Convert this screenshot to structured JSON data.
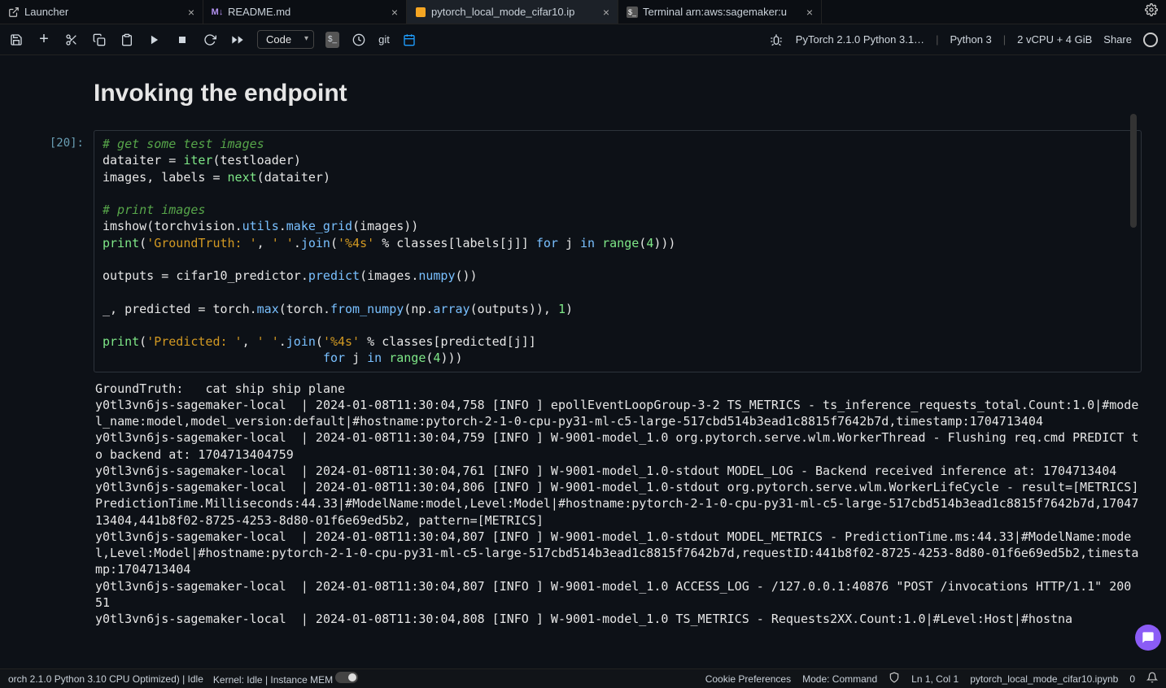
{
  "tabs": [
    {
      "label": "Launcher",
      "icon": "external"
    },
    {
      "label": "README.md",
      "icon": "markdown"
    },
    {
      "label": "pytorch_local_mode_cifar10.ip",
      "icon": "notebook",
      "active": true
    },
    {
      "label": "Terminal arn:aws:sagemaker:u",
      "icon": "terminal"
    }
  ],
  "toolbar": {
    "dropdown": "Code",
    "git_label": "git"
  },
  "toolbar_right": {
    "runtime": "PyTorch 2.1.0 Python 3.1…",
    "kernel": "Python 3",
    "compute": "2 vCPU + 4 GiB",
    "share": "Share"
  },
  "section_title": "Invoking the endpoint",
  "cell": {
    "prompt": "[20]:"
  },
  "output_text": "GroundTruth:   cat ship ship plane\ny0tl3vn6js-sagemaker-local  | 2024-01-08T11:30:04,758 [INFO ] epollEventLoopGroup-3-2 TS_METRICS - ts_inference_requests_total.Count:1.0|#model_name:model,model_version:default|#hostname:pytorch-2-1-0-cpu-py31-ml-c5-large-517cbd514b3ead1c8815f7642b7d,timestamp:1704713404\ny0tl3vn6js-sagemaker-local  | 2024-01-08T11:30:04,759 [INFO ] W-9001-model_1.0 org.pytorch.serve.wlm.WorkerThread - Flushing req.cmd PREDICT to backend at: 1704713404759\ny0tl3vn6js-sagemaker-local  | 2024-01-08T11:30:04,761 [INFO ] W-9001-model_1.0-stdout MODEL_LOG - Backend received inference at: 1704713404\ny0tl3vn6js-sagemaker-local  | 2024-01-08T11:30:04,806 [INFO ] W-9001-model_1.0-stdout org.pytorch.serve.wlm.WorkerLifeCycle - result=[METRICS]PredictionTime.Milliseconds:44.33|#ModelName:model,Level:Model|#hostname:pytorch-2-1-0-cpu-py31-ml-c5-large-517cbd514b3ead1c8815f7642b7d,1704713404,441b8f02-8725-4253-8d80-01f6e69ed5b2, pattern=[METRICS]\ny0tl3vn6js-sagemaker-local  | 2024-01-08T11:30:04,807 [INFO ] W-9001-model_1.0-stdout MODEL_METRICS - PredictionTime.ms:44.33|#ModelName:model,Level:Model|#hostname:pytorch-2-1-0-cpu-py31-ml-c5-large-517cbd514b3ead1c8815f7642b7d,requestID:441b8f02-8725-4253-8d80-01f6e69ed5b2,timestamp:1704713404\ny0tl3vn6js-sagemaker-local  | 2024-01-08T11:30:04,807 [INFO ] W-9001-model_1.0 ACCESS_LOG - /127.0.0.1:40876 \"POST /invocations HTTP/1.1\" 200 51\ny0tl3vn6js-sagemaker-local  | 2024-01-08T11:30:04,808 [INFO ] W-9001-model_1.0 TS_METRICS - Requests2XX.Count:1.0|#Level:Host|#hostna",
  "statusbar": {
    "left1": "orch 2.1.0 Python 3.10 CPU Optimized) | Idle",
    "left2": "Kernel: Idle | Instance MEM",
    "cookie": "Cookie Preferences",
    "mode": "Mode: Command",
    "lncol": "Ln 1, Col 1",
    "file": "pytorch_local_mode_cifar10.ipynb",
    "count": "0"
  }
}
